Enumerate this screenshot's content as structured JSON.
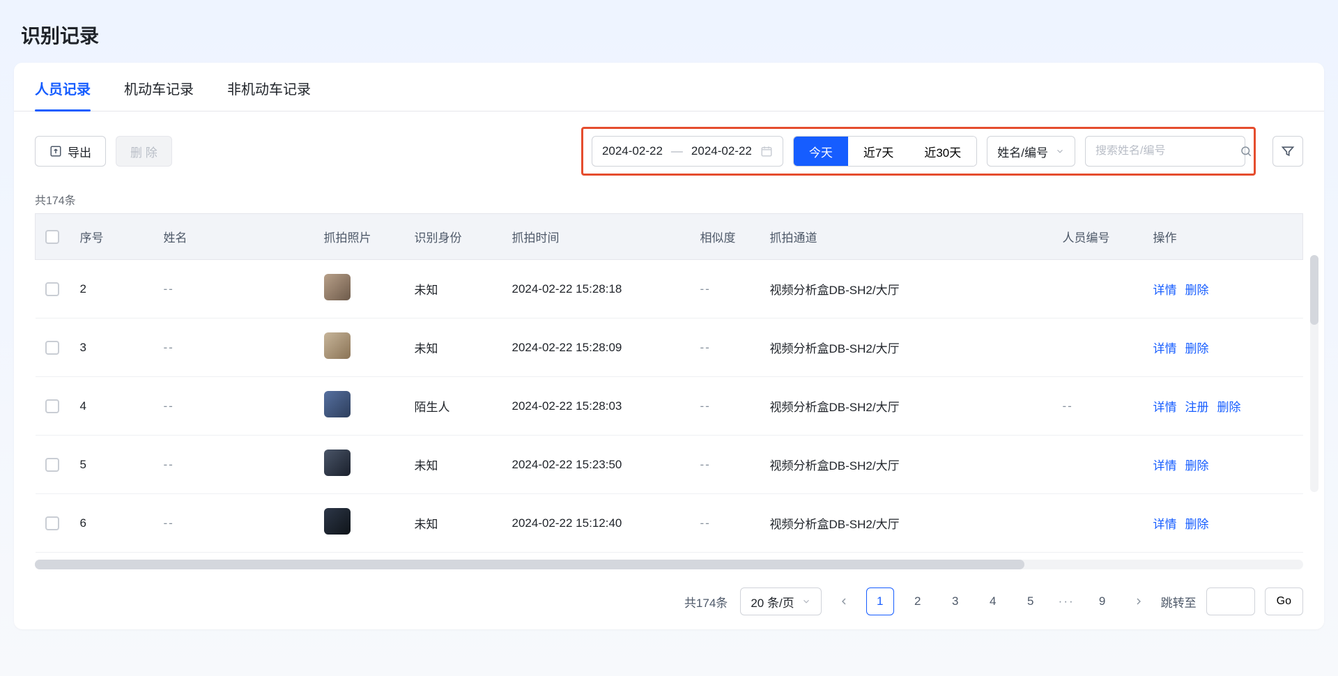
{
  "page_title": "识别记录",
  "tabs": {
    "personnel": "人员记录",
    "vehicle": "机动车记录",
    "nonmotor": "非机动车记录",
    "active": "personnel"
  },
  "toolbar": {
    "export_label": "导出",
    "delete_label": "删 除",
    "date_start": "2024-02-22",
    "date_end": "2024-02-22",
    "range_today": "今天",
    "range_7d": "近7天",
    "range_30d": "近30天",
    "search_field_label": "姓名/编号",
    "search_placeholder": "搜索姓名/编号"
  },
  "total_text": "共174条",
  "columns": {
    "seq": "序号",
    "name": "姓名",
    "photo": "抓拍照片",
    "identity": "识别身份",
    "time": "抓拍时间",
    "similarity": "相似度",
    "channel": "抓拍通道",
    "person_no": "人员编号",
    "ops": "操作"
  },
  "rows": [
    {
      "seq": "2",
      "name": "--",
      "identity": "未知",
      "time": "2024-02-22 15:28:18",
      "similarity": "--",
      "channel": "视频分析盒DB-SH2/大厅",
      "person_no": "",
      "ops": [
        "详情",
        "删除"
      ]
    },
    {
      "seq": "3",
      "name": "--",
      "identity": "未知",
      "time": "2024-02-22 15:28:09",
      "similarity": "--",
      "channel": "视频分析盒DB-SH2/大厅",
      "person_no": "",
      "ops": [
        "详情",
        "删除"
      ]
    },
    {
      "seq": "4",
      "name": "--",
      "identity": "陌生人",
      "time": "2024-02-22 15:28:03",
      "similarity": "--",
      "channel": "视频分析盒DB-SH2/大厅",
      "person_no": "--",
      "ops": [
        "详情",
        "注册",
        "删除"
      ]
    },
    {
      "seq": "5",
      "name": "--",
      "identity": "未知",
      "time": "2024-02-22 15:23:50",
      "similarity": "--",
      "channel": "视频分析盒DB-SH2/大厅",
      "person_no": "",
      "ops": [
        "详情",
        "删除"
      ]
    },
    {
      "seq": "6",
      "name": "--",
      "identity": "未知",
      "time": "2024-02-22 15:12:40",
      "similarity": "--",
      "channel": "视频分析盒DB-SH2/大厅",
      "person_no": "",
      "ops": [
        "详情",
        "删除"
      ]
    }
  ],
  "pagination": {
    "total_text": "共174条",
    "page_size_label": "20 条/页",
    "pages": [
      "1",
      "2",
      "3",
      "4",
      "5"
    ],
    "ellipsis": "···",
    "last_page": "9",
    "jump_label": "跳转至",
    "go_label": "Go"
  }
}
